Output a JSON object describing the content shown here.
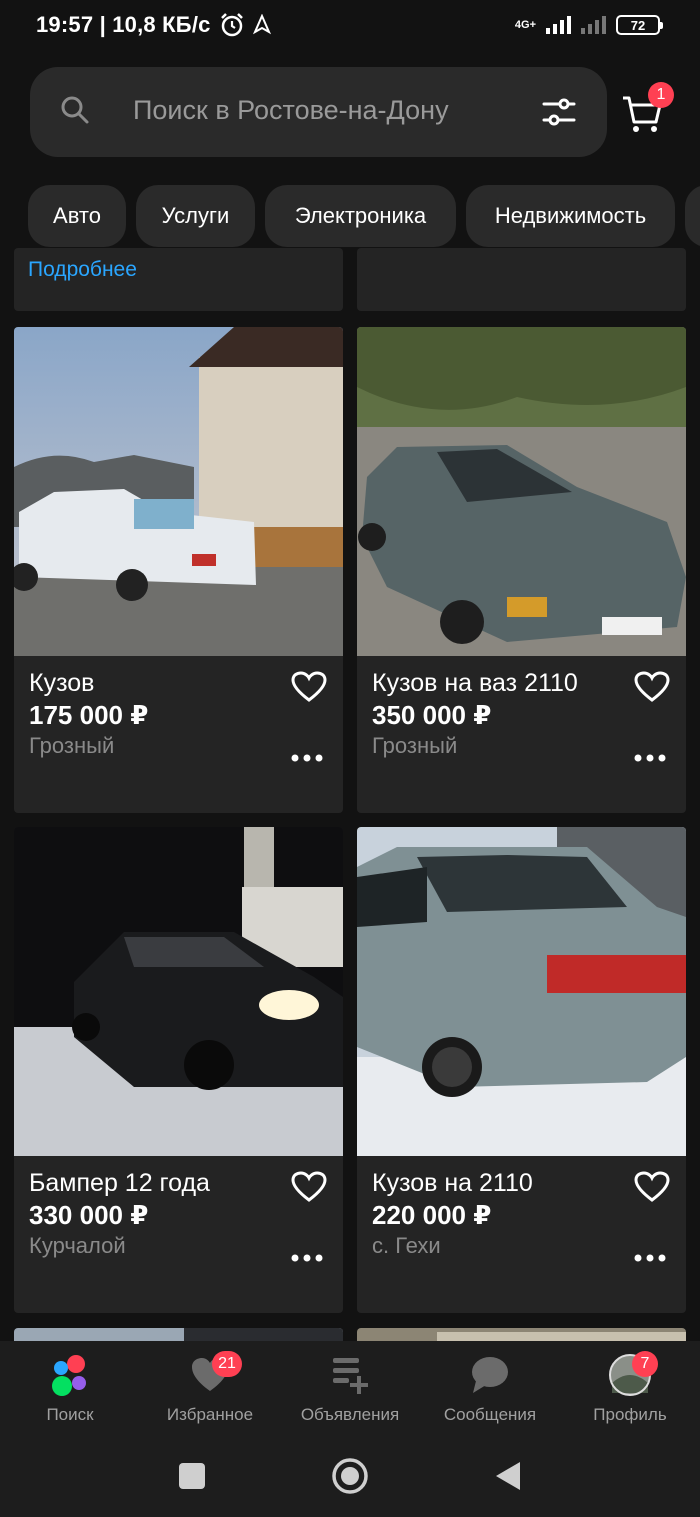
{
  "status_bar": {
    "time_speed": "19:57 | 10,8 КБ/с",
    "network": "4G+",
    "battery": "72"
  },
  "search": {
    "placeholder": "Поиск в Ростове-на-Дону",
    "cart_count": "1"
  },
  "categories": [
    "Авто",
    "Услуги",
    "Электроника",
    "Недвижимость"
  ],
  "partial_card": {
    "link": "Подробнее"
  },
  "listings": [
    {
      "title": "Кузов",
      "price": "175 000 ₽",
      "location": "Грозный"
    },
    {
      "title": "Кузов на ваз 2110",
      "price": "350 000 ₽",
      "location": "Грозный"
    },
    {
      "title": "Бампер 12 года",
      "price": "330 000 ₽",
      "location": "Курчалой"
    },
    {
      "title": "Кузов на 2110",
      "price": "220 000 ₽",
      "location": "с. Гехи"
    }
  ],
  "bottom_nav": {
    "items": [
      {
        "label": "Поиск",
        "icon": "search-app-icon"
      },
      {
        "label": "Избранное",
        "icon": "heart-icon",
        "badge": "21"
      },
      {
        "label": "Объявления",
        "icon": "listings-icon"
      },
      {
        "label": "Сообщения",
        "icon": "chat-icon"
      },
      {
        "label": "Профиль",
        "icon": "avatar",
        "badge": "7"
      }
    ]
  },
  "colors": {
    "background": "#121212",
    "card": "#242424",
    "accent_red": "#ff4053",
    "link_blue": "#2aa6ff"
  }
}
